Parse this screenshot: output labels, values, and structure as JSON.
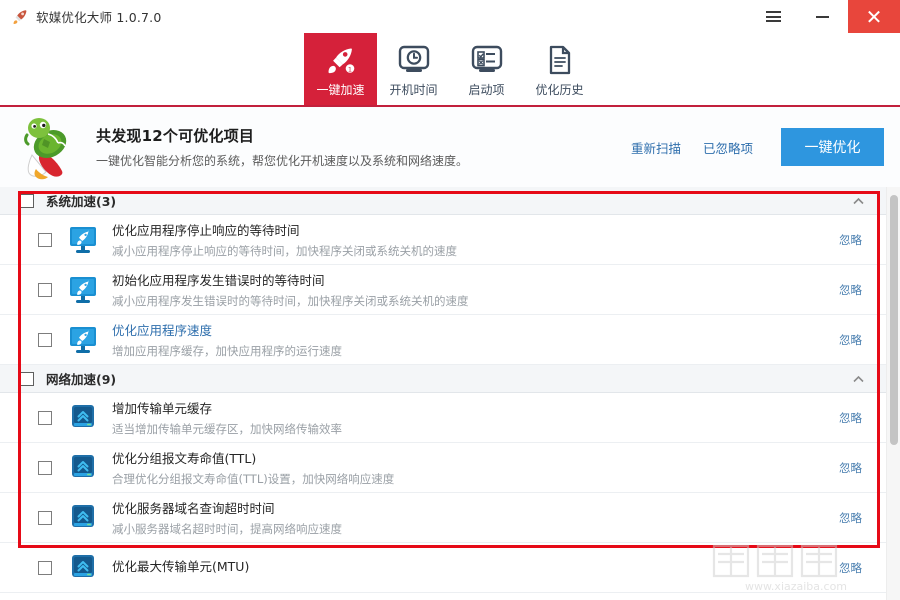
{
  "window": {
    "title": "软媒优化大师 1.0.7.0",
    "app_icon": "rocket-icon",
    "menu_icon": "hamburger-menu-icon",
    "minimize_icon": "minimize-icon",
    "close_icon": "close-icon",
    "close_color": "#e8463c"
  },
  "nav": {
    "tabs": [
      {
        "label": "一键加速",
        "icon": "rocket-icon",
        "active": true
      },
      {
        "label": "开机时间",
        "icon": "clock-monitor-icon",
        "active": false
      },
      {
        "label": "启动项",
        "icon": "checklist-monitor-icon",
        "active": false
      },
      {
        "label": "优化历史",
        "icon": "document-lines-icon",
        "active": false
      }
    ],
    "active_color": "#d5213a",
    "divider_color": "#c2203c"
  },
  "banner": {
    "mascot": "turtle-rocket-mascot",
    "title": "共发现12个可优化项目",
    "subtitle": "一键优化智能分析您的系统，帮您优化开机速度以及系统和网络速度。",
    "rescan_label": "重新扫描",
    "ignored_label": "已忽略项",
    "optimize_button": "一键优化",
    "button_color": "#2e96df"
  },
  "groups": [
    {
      "title": "系统加速(3)",
      "collapse_icon": "chevron-up-icon",
      "items": [
        {
          "title": "优化应用程序停止响应的等待时间",
          "desc": "减小应用程序停止响应的等待时间，加快程序关闭或系统关机的速度",
          "icon": "monitor-rocket-icon",
          "ignore": "忽略",
          "highlight": false
        },
        {
          "title": "初始化应用程序发生错误时的等待时间",
          "desc": "减小应用程序发生错误时的等待时间，加快程序关闭或系统关机的速度",
          "icon": "monitor-rocket-icon",
          "ignore": "忽略",
          "highlight": false
        },
        {
          "title": "优化应用程序速度",
          "desc": "增加应用程序缓存，加快应用程序的运行速度",
          "icon": "monitor-rocket-icon",
          "ignore": "忽略",
          "highlight": true
        }
      ]
    },
    {
      "title": "网络加速(9)",
      "collapse_icon": "chevron-up-icon",
      "items": [
        {
          "title": "增加传输单元缓存",
          "desc": "适当增加传输单元缓存区，加快网络传输效率",
          "icon": "monitor-uparrows-icon",
          "ignore": "忽略",
          "highlight": false
        },
        {
          "title": "优化分组报文寿命值(TTL)",
          "desc": "合理优化分组报文寿命值(TTL)设置，加快网络响应速度",
          "icon": "monitor-uparrows-icon",
          "ignore": "忽略",
          "highlight": false
        },
        {
          "title": "优化服务器域名查询超时时间",
          "desc": "减小服务器域名超时时间，提高网络响应速度",
          "icon": "monitor-uparrows-icon",
          "ignore": "忽略",
          "highlight": false
        },
        {
          "title": "优化最大传输单元(MTU)",
          "desc": "",
          "icon": "monitor-uparrows-icon",
          "ignore": "忽略",
          "highlight": false
        }
      ]
    }
  ],
  "annotation": {
    "color": "#e60a17"
  },
  "watermark": {
    "text": "下载吧",
    "url": "www.xiazaiba.com"
  }
}
